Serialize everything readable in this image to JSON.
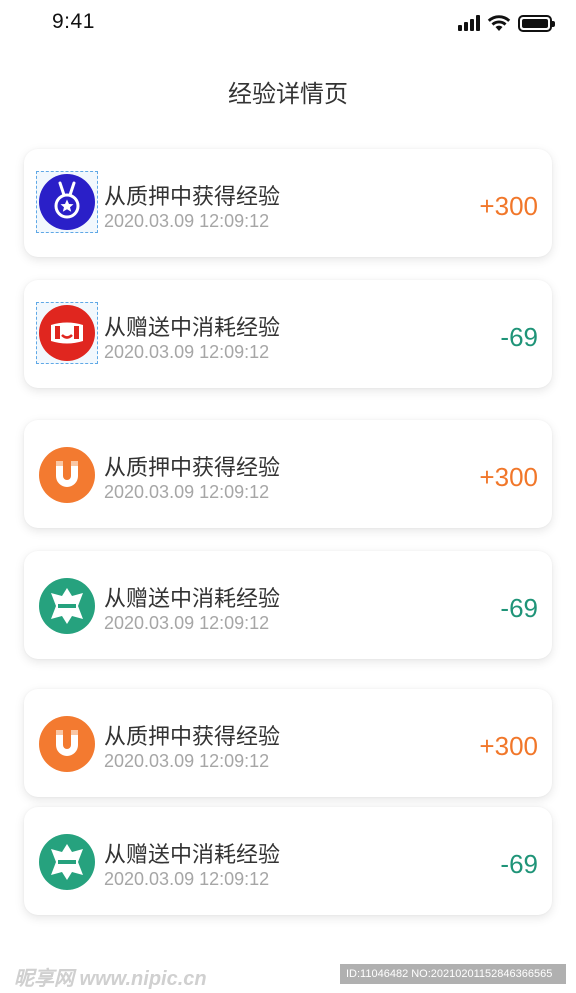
{
  "status_bar": {
    "time": "9:41",
    "icons": [
      "signal-icon",
      "wifi-icon",
      "battery-icon"
    ]
  },
  "page": {
    "title": "经验详情页"
  },
  "records": [
    {
      "icon": "medal-icon",
      "icon_color": "#2a1fc8",
      "title": "从质押中获得经验",
      "time": "2020.03.09 12:09:12",
      "value": "+300",
      "kind": "gain"
    },
    {
      "icon": "red-packet-icon",
      "icon_color": "#e0261f",
      "title": "从赠送中消耗经验",
      "time": "2020.03.09 12:09:12",
      "value": "-69",
      "kind": "loss"
    },
    {
      "icon": "magnet-icon",
      "icon_color": "#f37a30",
      "title": "从质押中获得经验",
      "time": "2020.03.09 12:09:12",
      "value": "+300",
      "kind": "gain"
    },
    {
      "icon": "gift-icon",
      "icon_color": "#26a27e",
      "title": "从赠送中消耗经验",
      "time": "2020.03.09 12:09:12",
      "value": "-69",
      "kind": "loss"
    },
    {
      "icon": "magnet-icon",
      "icon_color": "#f37a30",
      "title": "从质押中获得经验",
      "time": "2020.03.09 12:09:12",
      "value": "+300",
      "kind": "gain"
    },
    {
      "icon": "gift-icon",
      "icon_color": "#26a27e",
      "title": "从赠送中消耗经验",
      "time": "2020.03.09 12:09:12",
      "value": "-69",
      "kind": "loss"
    }
  ],
  "colors": {
    "gain": "#f1772a",
    "loss": "#1f9478"
  },
  "watermark": {
    "logo": "昵享网 www.nipic.cn",
    "id_text": "ID:11046482 NO:20210201152846366565"
  }
}
